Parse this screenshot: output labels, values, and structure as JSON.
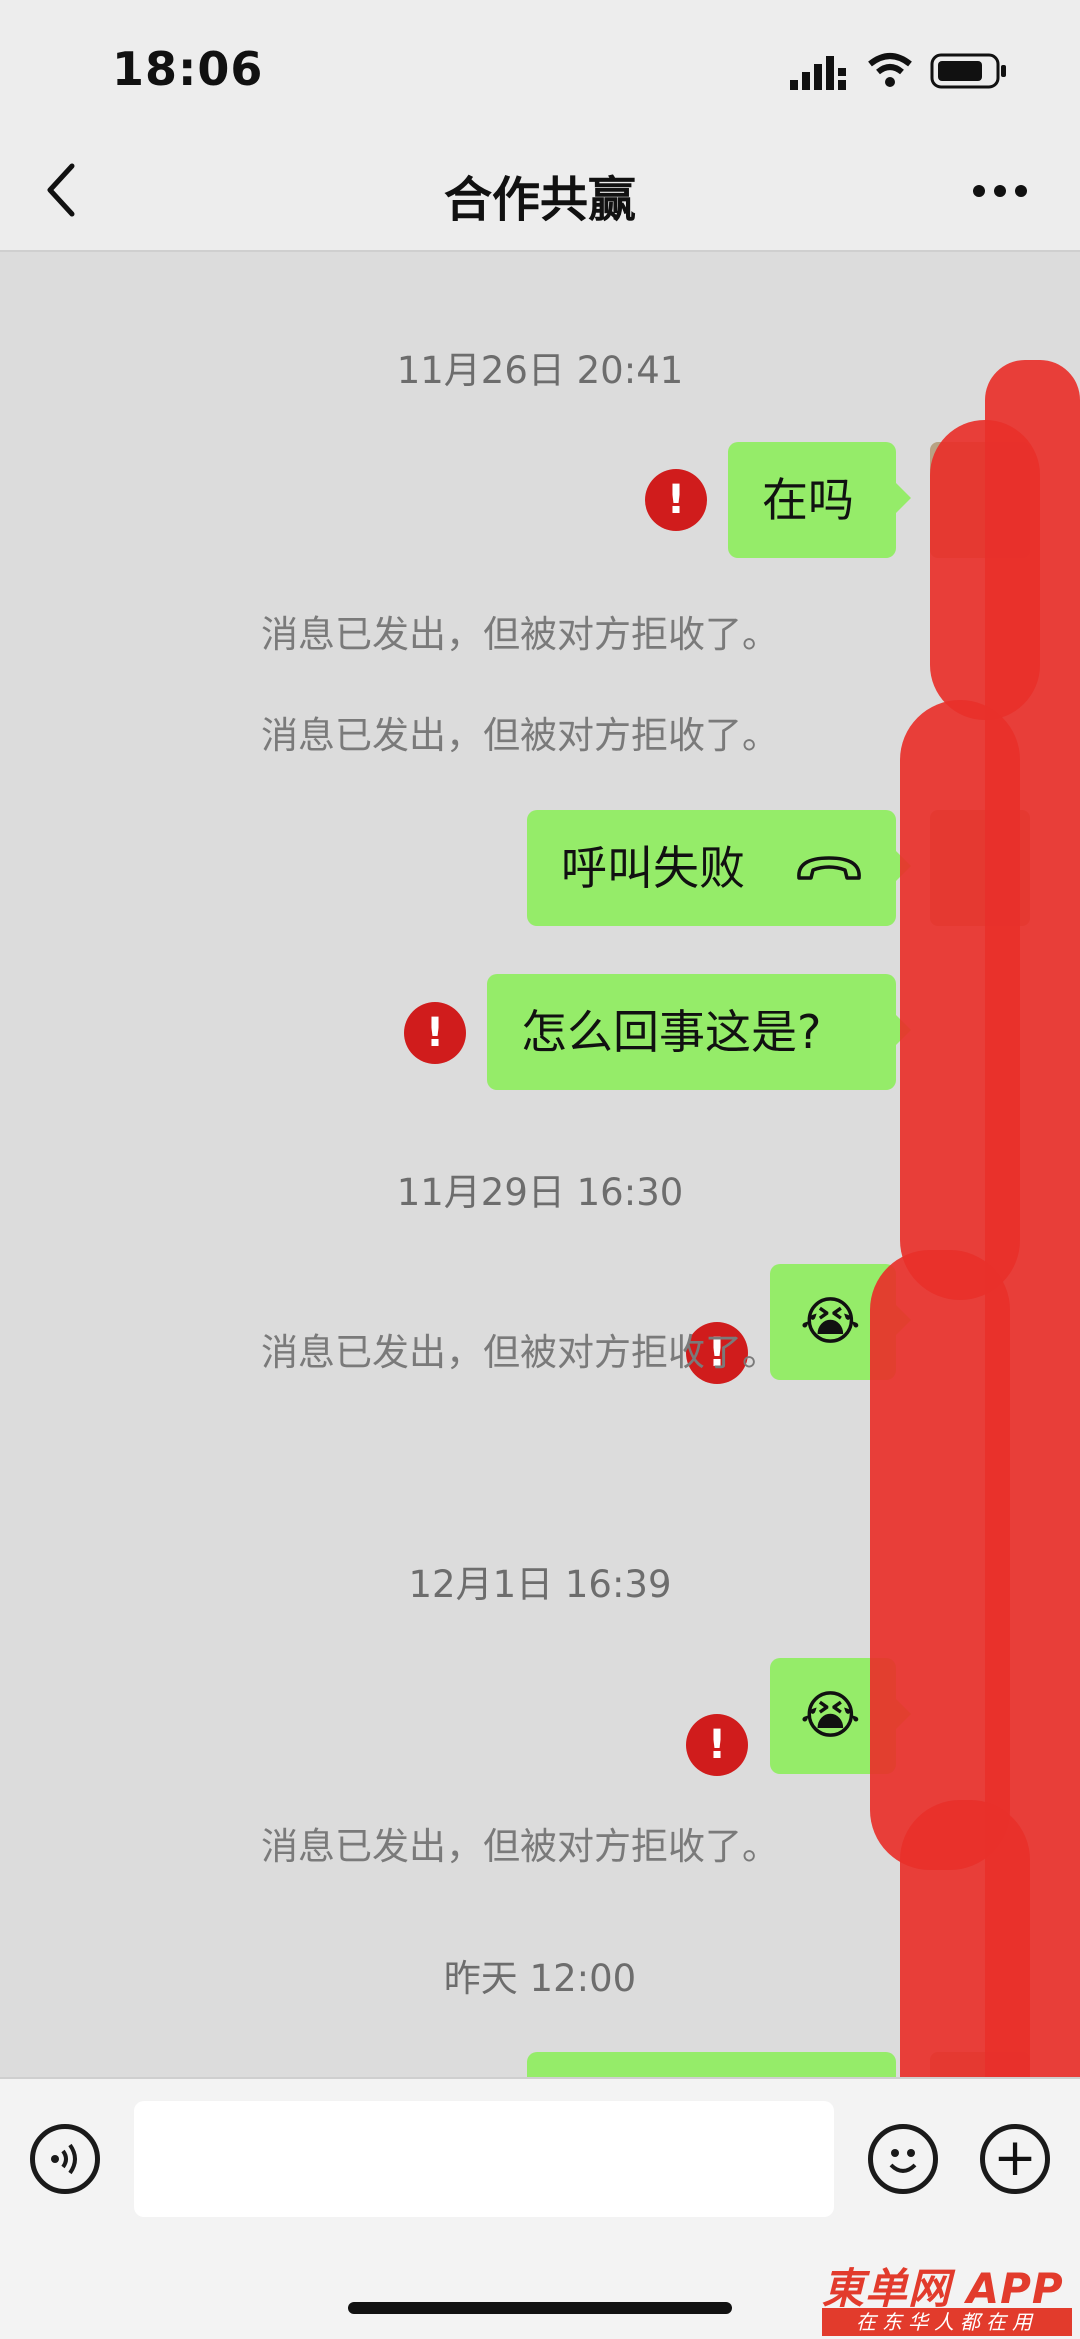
{
  "status_bar": {
    "time": "18:06"
  },
  "nav": {
    "title": "合作共赢",
    "back_icon": "chevron-left-icon",
    "more_icon": "ellipsis-icon"
  },
  "chat": {
    "messages": [
      {
        "type": "time",
        "text": "11月26日 20:41"
      },
      {
        "type": "bubble",
        "text": "在吗",
        "failed": true
      },
      {
        "type": "system",
        "text": "消息已发出，但被对方拒收了。"
      },
      {
        "type": "system",
        "text": "消息已发出，但被对方拒收了。"
      },
      {
        "type": "bubble",
        "text": "呼叫失败",
        "icon": "phone-hangup-icon",
        "failed": false
      },
      {
        "type": "bubble",
        "text": "怎么回事这是?",
        "failed": true
      },
      {
        "type": "time",
        "text": "11月29日 16:30"
      },
      {
        "type": "bubble",
        "text": "😭",
        "failed": true
      },
      {
        "type": "system",
        "text": "消息已发出，但被对方拒收了。"
      },
      {
        "type": "time",
        "text": "12月1日 16:39"
      },
      {
        "type": "bubble",
        "text": "😭",
        "failed": true
      },
      {
        "type": "system",
        "text": "消息已发出，但被对方拒收了。"
      },
      {
        "type": "time",
        "text": "昨天 12:00"
      }
    ],
    "error_mark": "!"
  },
  "input_bar": {
    "voice_icon": "voice-icon",
    "emoji_icon": "smiley-icon",
    "plus_icon": "plus-icon",
    "plus_symbol": "+"
  },
  "watermark": {
    "logo": "東单网 APP",
    "sub": "在东华人都在用"
  },
  "colors": {
    "bubble": "#95ec69",
    "error": "#d01c1c",
    "redaction": "#e8302a"
  }
}
